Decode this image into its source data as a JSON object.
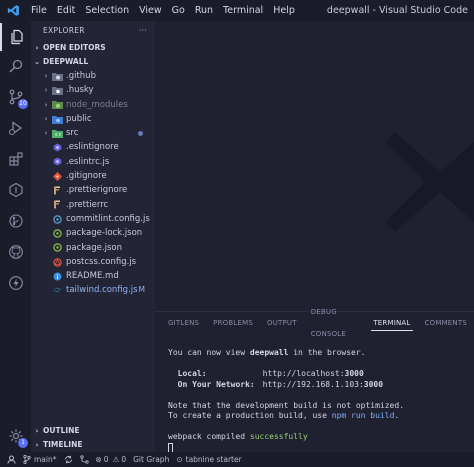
{
  "titlebar": {
    "menu": [
      "File",
      "Edit",
      "Selection",
      "View",
      "Go",
      "Run",
      "Terminal",
      "Help"
    ],
    "title": "deepwall - Visual Studio Code"
  },
  "activity": {
    "scm_badge": "10",
    "accounts_badge": "1"
  },
  "sidebar": {
    "header": "EXPLORER",
    "more": "···",
    "open_editors": "OPEN EDITORS",
    "project": "DEEPWALL",
    "items": [
      {
        "label": ".github",
        "type": "folder",
        "icon": "github-folder-icon"
      },
      {
        "label": ".husky",
        "type": "folder",
        "icon": "husky-folder-icon"
      },
      {
        "label": "node_modules",
        "type": "folder",
        "icon": "node-folder-icon"
      },
      {
        "label": "public",
        "type": "folder",
        "icon": "public-folder-icon"
      },
      {
        "label": "src",
        "type": "folder",
        "icon": "src-folder-icon"
      },
      {
        "label": ".eslintignore",
        "type": "file",
        "icon": "eslint-icon"
      },
      {
        "label": ".eslintrc.js",
        "type": "file",
        "icon": "eslint-icon"
      },
      {
        "label": ".gitignore",
        "type": "file",
        "icon": "git-icon"
      },
      {
        "label": ".prettierignore",
        "type": "file",
        "icon": "prettier-icon"
      },
      {
        "label": ".prettierrc",
        "type": "file",
        "icon": "prettier-icon"
      },
      {
        "label": "commitlint.config.js",
        "type": "file",
        "icon": "commitlint-icon"
      },
      {
        "label": "package-lock.json",
        "type": "file",
        "icon": "npm-icon"
      },
      {
        "label": "package.json",
        "type": "file",
        "icon": "npm-icon"
      },
      {
        "label": "postcss.config.js",
        "type": "file",
        "icon": "postcss-icon"
      },
      {
        "label": "README.md",
        "type": "file",
        "icon": "info-icon"
      },
      {
        "label": "tailwind.config.js",
        "type": "file",
        "icon": "tailwind-icon",
        "status": "M"
      }
    ],
    "outline": "OUTLINE",
    "timeline": "TIMELINE"
  },
  "panel": {
    "tabs": [
      "GITLENS",
      "PROBLEMS",
      "OUTPUT",
      "DEBUG CONSOLE",
      "TERMINAL",
      "COMMENTS"
    ],
    "active_tab": "TERMINAL",
    "terminal": {
      "line1_pre": "You can now view ",
      "line1_app": "deepwall",
      "line1_post": " in the browser.",
      "local_label": "Local:",
      "local_url_pre": "http://localhost:",
      "local_port": "3000",
      "network_label": "On Your Network:",
      "network_url_pre": "http://192.168.1.103:",
      "network_port": "3000",
      "note1": "Note that the development build is not optimized.",
      "note2_pre": "To create a production build, use ",
      "note2_cmd": "npm run build",
      "note2_post": ".",
      "compiled_pre": "webpack compiled ",
      "compiled_status": "successfully"
    }
  },
  "statusbar": {
    "branch": "main*",
    "errors": "0",
    "warnings": "0",
    "gitgraph": "Git Graph",
    "tabnine": "tabnine starter"
  },
  "colors": {
    "bg": "#1f2030",
    "sidebar": "#232435",
    "accent": "#5b6ef5",
    "success": "#9ed072"
  }
}
